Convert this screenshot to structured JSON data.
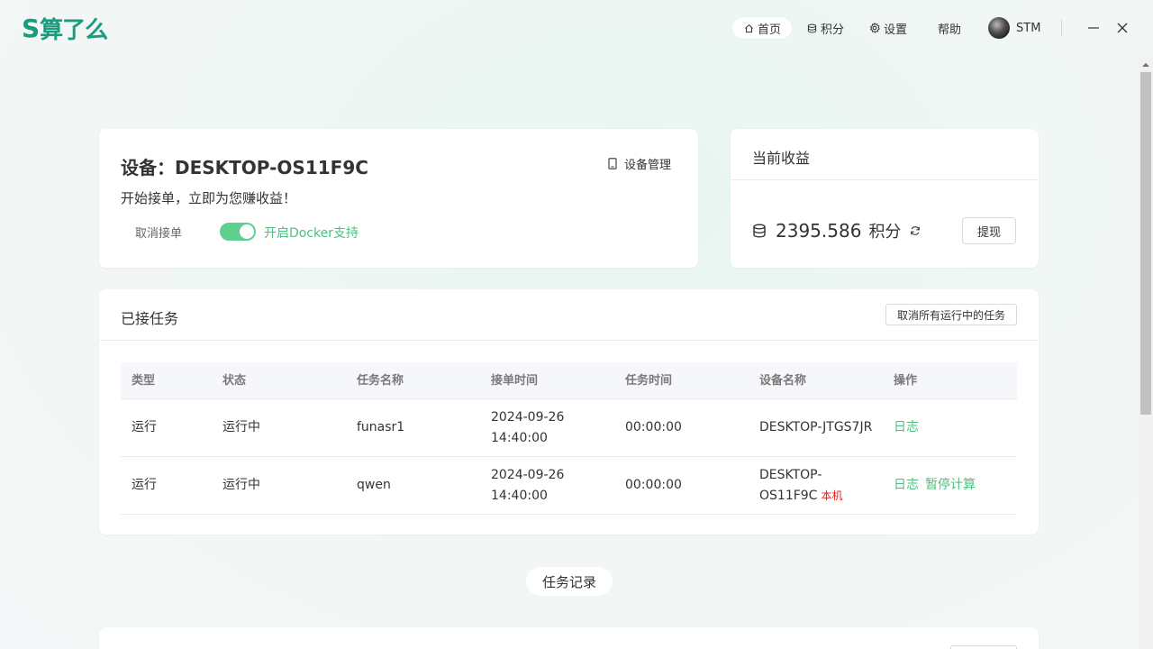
{
  "app": {
    "logo_text": "算了么",
    "logo_mark": "S"
  },
  "nav": {
    "items": [
      {
        "label": "首页",
        "icon": "home-icon",
        "active": true
      },
      {
        "label": "积分",
        "icon": "coins-icon",
        "active": false
      },
      {
        "label": "设置",
        "icon": "gear-icon",
        "active": false
      },
      {
        "label": "帮助",
        "icon": "",
        "active": false
      }
    ]
  },
  "user": {
    "name": "STM"
  },
  "device": {
    "title": "设备：DESKTOP-OS11F9C",
    "manage_label": "设备管理",
    "subtitle": "开始接单，立即为您赚收益！",
    "cancel_label": "取消接单",
    "docker_toggle_on": true,
    "docker_label": "开启Docker支持"
  },
  "earnings": {
    "title": "当前收益",
    "amount": "2395.586",
    "unit": "积分",
    "withdraw_label": "提现"
  },
  "tasks": {
    "title": "已接任务",
    "cancel_all_label": "取消所有运行中的任务",
    "columns": [
      "类型",
      "状态",
      "任务名称",
      "接单时间",
      "任务时间",
      "设备名称",
      "操作"
    ],
    "rows": [
      {
        "type": "运行",
        "status": "运行中",
        "name": "funasr1",
        "accept_date": "2024-09-26",
        "accept_time": "14:40:00",
        "duration": "00:00:00",
        "device_line1": "DESKTOP-JTGS7JR",
        "device_line2": "",
        "local_tag": "",
        "actions": [
          "日志"
        ]
      },
      {
        "type": "运行",
        "status": "运行中",
        "name": "qwen",
        "accept_date": "2024-09-26",
        "accept_time": "14:40:00",
        "duration": "00:00:00",
        "device_line1": "DESKTOP-",
        "device_line2": "OS11F9C",
        "local_tag": "本机",
        "actions": [
          "日志",
          "暂停计算"
        ]
      }
    ]
  },
  "records_label": "任务记录",
  "colors": {
    "brand": "#1a9b7e",
    "accent_green": "#4cc17f",
    "toggle_on": "#5fcf8f",
    "local_tag": "#e02020"
  }
}
